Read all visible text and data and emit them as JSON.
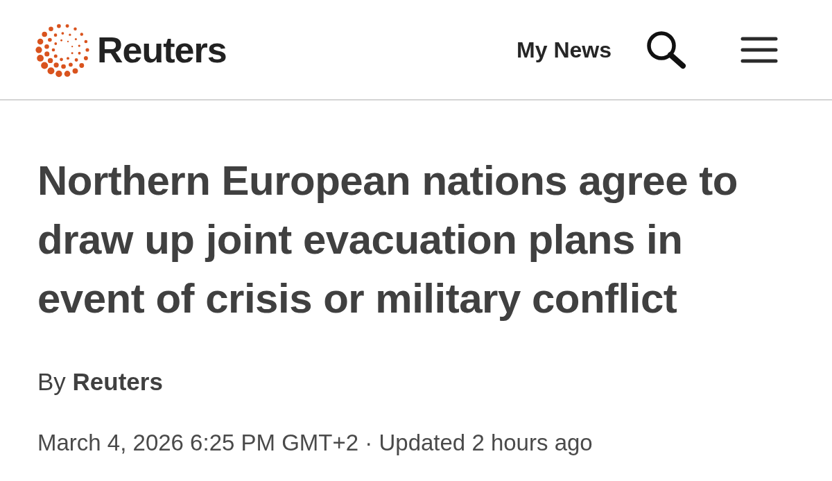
{
  "header": {
    "logo": {
      "text": "Reuters"
    },
    "my_news": {
      "label": "My News"
    }
  },
  "article": {
    "headline": "Northern European nations agree to draw up joint evacuation plans in event of crisis or military conflict",
    "byline": "By **Reuters**",
    "dateline": "March 4, 2026 6:25 PM GMT+2 · Updated 2 hours ago"
  }
}
